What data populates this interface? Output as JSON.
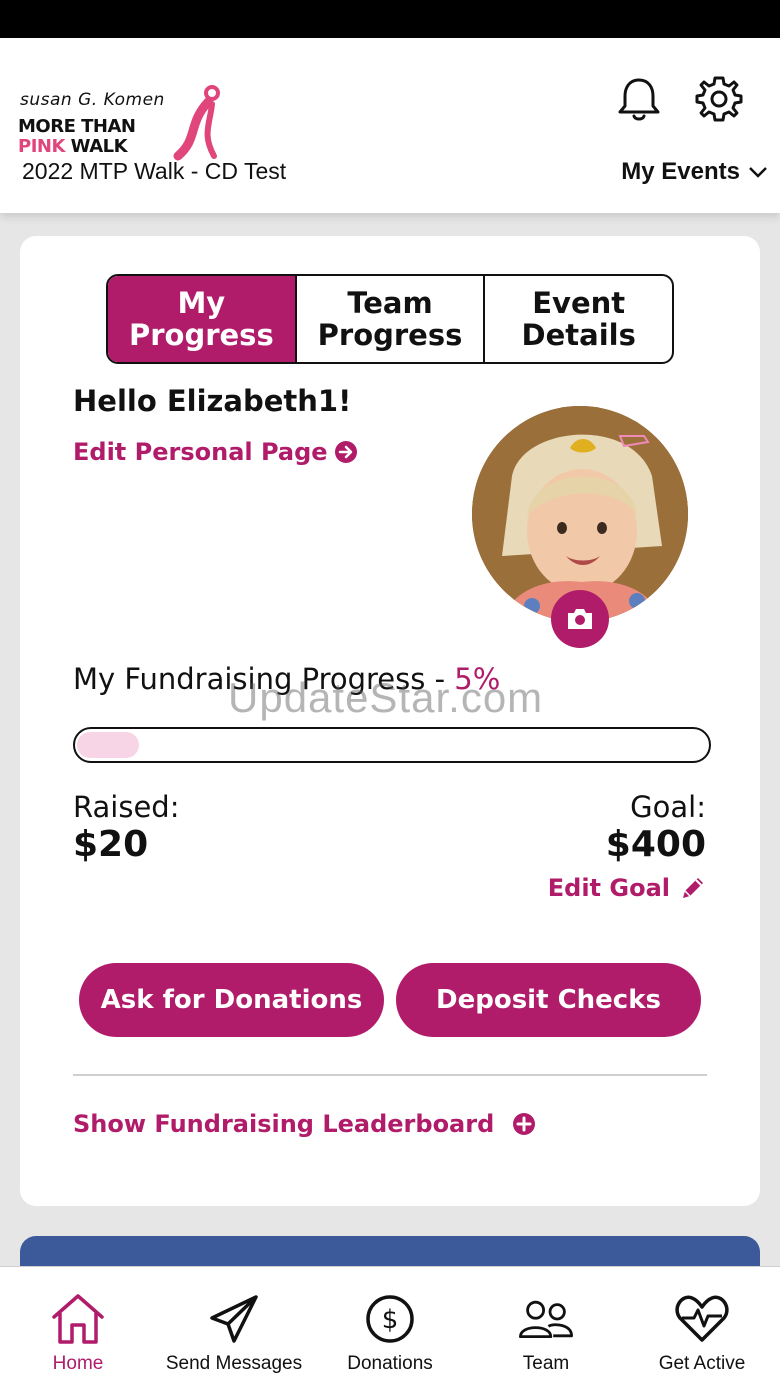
{
  "header": {
    "logo": {
      "line1": "susan G. Komen",
      "line2": "MORE THAN",
      "line3_pink": "PINK",
      "line3_dark": " WALK"
    },
    "event_name": "2022 MTP Walk - CD Test",
    "my_events_label": "My Events"
  },
  "tabs": [
    {
      "label": "My Progress",
      "active": true
    },
    {
      "label": "Team Progress",
      "active": false
    },
    {
      "label": "Event Details",
      "active": false
    }
  ],
  "profile": {
    "greeting": "Hello Elizabeth1!",
    "edit_page_label": "Edit Personal Page"
  },
  "fundraising": {
    "title": "My Fundraising Progress - ",
    "percent_label": "5%",
    "progress_fraction": 0.05,
    "raised_label": "Raised:",
    "raised_value": "$20",
    "goal_label": "Goal:",
    "goal_value": "$400",
    "edit_goal_label": "Edit Goal"
  },
  "actions": {
    "ask_label": "Ask for Donations",
    "deposit_label": "Deposit Checks",
    "leaderboard_label": "Show Fundraising Leaderboard"
  },
  "watermark": "UpdateStar.com",
  "bottom_nav": [
    {
      "label": "Home",
      "icon": "home-icon",
      "active": true
    },
    {
      "label": "Send Messages",
      "icon": "paper-plane-icon",
      "active": false
    },
    {
      "label": "Donations",
      "icon": "dollar-circle-icon",
      "active": false
    },
    {
      "label": "Team",
      "icon": "users-icon",
      "active": false
    },
    {
      "label": "Get Active",
      "icon": "heartbeat-icon",
      "active": false
    }
  ],
  "colors": {
    "brand_pink": "#b01c6a",
    "progress_fill": "#f8d5e6",
    "blue_card": "#3c5a99"
  }
}
